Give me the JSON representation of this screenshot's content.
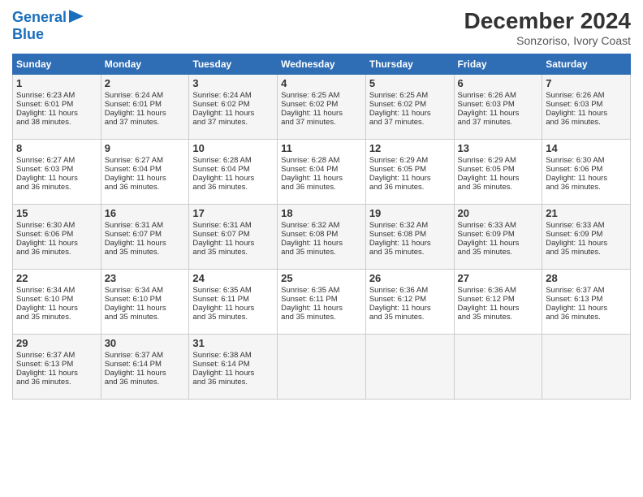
{
  "header": {
    "logo_line1": "General",
    "logo_line2": "Blue",
    "month": "December 2024",
    "location": "Sonzoriso, Ivory Coast"
  },
  "weekdays": [
    "Sunday",
    "Monday",
    "Tuesday",
    "Wednesday",
    "Thursday",
    "Friday",
    "Saturday"
  ],
  "weeks": [
    [
      {
        "day": "1",
        "lines": [
          "Sunrise: 6:23 AM",
          "Sunset: 6:01 PM",
          "Daylight: 11 hours",
          "and 38 minutes."
        ]
      },
      {
        "day": "2",
        "lines": [
          "Sunrise: 6:24 AM",
          "Sunset: 6:01 PM",
          "Daylight: 11 hours",
          "and 37 minutes."
        ]
      },
      {
        "day": "3",
        "lines": [
          "Sunrise: 6:24 AM",
          "Sunset: 6:02 PM",
          "Daylight: 11 hours",
          "and 37 minutes."
        ]
      },
      {
        "day": "4",
        "lines": [
          "Sunrise: 6:25 AM",
          "Sunset: 6:02 PM",
          "Daylight: 11 hours",
          "and 37 minutes."
        ]
      },
      {
        "day": "5",
        "lines": [
          "Sunrise: 6:25 AM",
          "Sunset: 6:02 PM",
          "Daylight: 11 hours",
          "and 37 minutes."
        ]
      },
      {
        "day": "6",
        "lines": [
          "Sunrise: 6:26 AM",
          "Sunset: 6:03 PM",
          "Daylight: 11 hours",
          "and 37 minutes."
        ]
      },
      {
        "day": "7",
        "lines": [
          "Sunrise: 6:26 AM",
          "Sunset: 6:03 PM",
          "Daylight: 11 hours",
          "and 36 minutes."
        ]
      }
    ],
    [
      {
        "day": "8",
        "lines": [
          "Sunrise: 6:27 AM",
          "Sunset: 6:03 PM",
          "Daylight: 11 hours",
          "and 36 minutes."
        ]
      },
      {
        "day": "9",
        "lines": [
          "Sunrise: 6:27 AM",
          "Sunset: 6:04 PM",
          "Daylight: 11 hours",
          "and 36 minutes."
        ]
      },
      {
        "day": "10",
        "lines": [
          "Sunrise: 6:28 AM",
          "Sunset: 6:04 PM",
          "Daylight: 11 hours",
          "and 36 minutes."
        ]
      },
      {
        "day": "11",
        "lines": [
          "Sunrise: 6:28 AM",
          "Sunset: 6:04 PM",
          "Daylight: 11 hours",
          "and 36 minutes."
        ]
      },
      {
        "day": "12",
        "lines": [
          "Sunrise: 6:29 AM",
          "Sunset: 6:05 PM",
          "Daylight: 11 hours",
          "and 36 minutes."
        ]
      },
      {
        "day": "13",
        "lines": [
          "Sunrise: 6:29 AM",
          "Sunset: 6:05 PM",
          "Daylight: 11 hours",
          "and 36 minutes."
        ]
      },
      {
        "day": "14",
        "lines": [
          "Sunrise: 6:30 AM",
          "Sunset: 6:06 PM",
          "Daylight: 11 hours",
          "and 36 minutes."
        ]
      }
    ],
    [
      {
        "day": "15",
        "lines": [
          "Sunrise: 6:30 AM",
          "Sunset: 6:06 PM",
          "Daylight: 11 hours",
          "and 36 minutes."
        ]
      },
      {
        "day": "16",
        "lines": [
          "Sunrise: 6:31 AM",
          "Sunset: 6:07 PM",
          "Daylight: 11 hours",
          "and 35 minutes."
        ]
      },
      {
        "day": "17",
        "lines": [
          "Sunrise: 6:31 AM",
          "Sunset: 6:07 PM",
          "Daylight: 11 hours",
          "and 35 minutes."
        ]
      },
      {
        "day": "18",
        "lines": [
          "Sunrise: 6:32 AM",
          "Sunset: 6:08 PM",
          "Daylight: 11 hours",
          "and 35 minutes."
        ]
      },
      {
        "day": "19",
        "lines": [
          "Sunrise: 6:32 AM",
          "Sunset: 6:08 PM",
          "Daylight: 11 hours",
          "and 35 minutes."
        ]
      },
      {
        "day": "20",
        "lines": [
          "Sunrise: 6:33 AM",
          "Sunset: 6:09 PM",
          "Daylight: 11 hours",
          "and 35 minutes."
        ]
      },
      {
        "day": "21",
        "lines": [
          "Sunrise: 6:33 AM",
          "Sunset: 6:09 PM",
          "Daylight: 11 hours",
          "and 35 minutes."
        ]
      }
    ],
    [
      {
        "day": "22",
        "lines": [
          "Sunrise: 6:34 AM",
          "Sunset: 6:10 PM",
          "Daylight: 11 hours",
          "and 35 minutes."
        ]
      },
      {
        "day": "23",
        "lines": [
          "Sunrise: 6:34 AM",
          "Sunset: 6:10 PM",
          "Daylight: 11 hours",
          "and 35 minutes."
        ]
      },
      {
        "day": "24",
        "lines": [
          "Sunrise: 6:35 AM",
          "Sunset: 6:11 PM",
          "Daylight: 11 hours",
          "and 35 minutes."
        ]
      },
      {
        "day": "25",
        "lines": [
          "Sunrise: 6:35 AM",
          "Sunset: 6:11 PM",
          "Daylight: 11 hours",
          "and 35 minutes."
        ]
      },
      {
        "day": "26",
        "lines": [
          "Sunrise: 6:36 AM",
          "Sunset: 6:12 PM",
          "Daylight: 11 hours",
          "and 35 minutes."
        ]
      },
      {
        "day": "27",
        "lines": [
          "Sunrise: 6:36 AM",
          "Sunset: 6:12 PM",
          "Daylight: 11 hours",
          "and 35 minutes."
        ]
      },
      {
        "day": "28",
        "lines": [
          "Sunrise: 6:37 AM",
          "Sunset: 6:13 PM",
          "Daylight: 11 hours",
          "and 36 minutes."
        ]
      }
    ],
    [
      {
        "day": "29",
        "lines": [
          "Sunrise: 6:37 AM",
          "Sunset: 6:13 PM",
          "Daylight: 11 hours",
          "and 36 minutes."
        ]
      },
      {
        "day": "30",
        "lines": [
          "Sunrise: 6:37 AM",
          "Sunset: 6:14 PM",
          "Daylight: 11 hours",
          "and 36 minutes."
        ]
      },
      {
        "day": "31",
        "lines": [
          "Sunrise: 6:38 AM",
          "Sunset: 6:14 PM",
          "Daylight: 11 hours",
          "and 36 minutes."
        ]
      },
      null,
      null,
      null,
      null
    ]
  ]
}
